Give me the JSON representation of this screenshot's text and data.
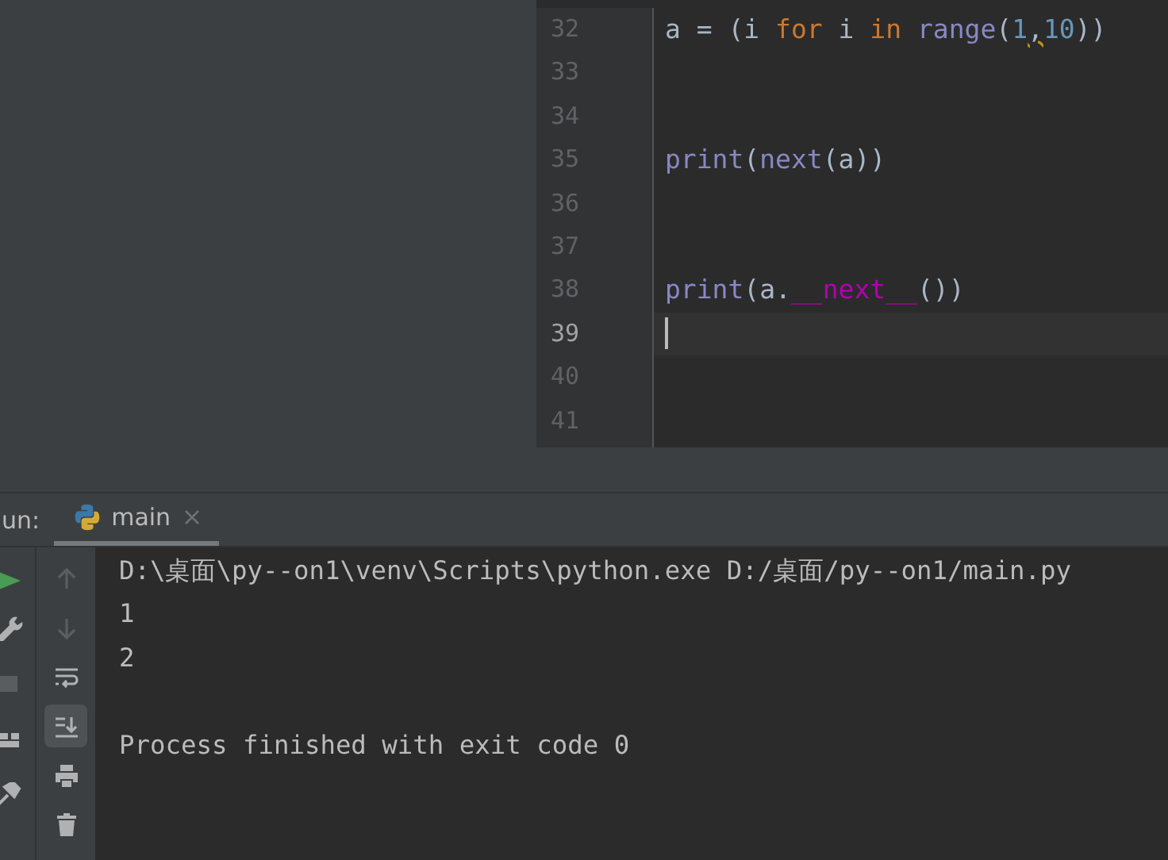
{
  "editor": {
    "lines": [
      {
        "number": "32",
        "current": false,
        "tokens": [
          {
            "text": "a = (i ",
            "kind": "plain"
          },
          {
            "text": "for",
            "kind": "keyword"
          },
          {
            "text": " i ",
            "kind": "plain"
          },
          {
            "text": "in ",
            "kind": "keyword"
          },
          {
            "text": "range",
            "kind": "builtin"
          },
          {
            "text": "(",
            "kind": "plain"
          },
          {
            "text": "1",
            "kind": "number"
          },
          {
            "text": ",",
            "kind": "warning"
          },
          {
            "text": "10",
            "kind": "number"
          },
          {
            "text": "))",
            "kind": "plain"
          }
        ]
      },
      {
        "number": "33",
        "current": false
      },
      {
        "number": "34",
        "current": false
      },
      {
        "number": "35",
        "current": false,
        "tokens": [
          {
            "text": "print",
            "kind": "builtin"
          },
          {
            "text": "(",
            "kind": "plain"
          },
          {
            "text": "next",
            "kind": "builtin"
          },
          {
            "text": "(a))",
            "kind": "plain"
          }
        ]
      },
      {
        "number": "36",
        "current": false
      },
      {
        "number": "37",
        "current": false
      },
      {
        "number": "38",
        "current": false,
        "tokens": [
          {
            "text": "print",
            "kind": "builtin"
          },
          {
            "text": "(a.",
            "kind": "plain"
          },
          {
            "text": "__next__",
            "kind": "magic"
          },
          {
            "text": "())",
            "kind": "plain"
          }
        ]
      },
      {
        "number": "39",
        "current": true
      },
      {
        "number": "40",
        "current": false
      },
      {
        "number": "41",
        "current": false
      }
    ]
  },
  "run_panel": {
    "label": "un:",
    "tabs": [
      {
        "label": "main",
        "selected": true
      }
    ],
    "left_tools": [
      {
        "kind": "run"
      },
      {
        "kind": "wrench"
      },
      {
        "kind": "stop"
      },
      {
        "kind": "layout"
      },
      {
        "kind": "pin"
      }
    ],
    "tools": [
      {
        "kind": "up",
        "disabled": true,
        "selected": false
      },
      {
        "kind": "down",
        "disabled": true,
        "selected": false
      },
      {
        "kind": "wrap",
        "disabled": false,
        "selected": false
      },
      {
        "kind": "scroll-end",
        "disabled": false,
        "selected": true
      },
      {
        "kind": "print",
        "disabled": false,
        "selected": false
      },
      {
        "kind": "trash",
        "disabled": false,
        "selected": false
      }
    ],
    "console": [
      {
        "text": "D:\\桌面\\py--on1\\venv\\Scripts\\python.exe D:/桌面/py--on1/main.py",
        "kind": "command"
      },
      {
        "text": "1",
        "kind": "output"
      },
      {
        "text": "2",
        "kind": "output"
      },
      {
        "text": "Process finished with exit code 0",
        "kind": "status"
      }
    ]
  }
}
